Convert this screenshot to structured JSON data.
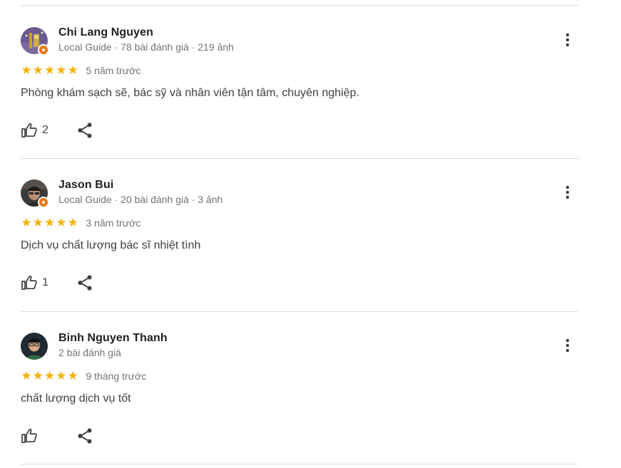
{
  "reviews": [
    {
      "name": "Chi Lang Nguyen",
      "meta": "Local Guide · 78 bài đánh giá · 219 ảnh",
      "local_guide": true,
      "rating": 5,
      "when": "5 năm trước",
      "text": "Phòng khám sạch sẽ, bác sỹ và nhân viên tận tâm, chuyên nghiệp.",
      "likes": "2",
      "avatar_colors": [
        "#6b5a8f",
        "#c9a227"
      ]
    },
    {
      "name": "Jason Bui",
      "meta": "Local Guide · 20 bài đánh giá · 3 ảnh",
      "local_guide": true,
      "rating": 5,
      "when": "3 năm trước",
      "text": "Dịch vụ chất lượng bác sĩ nhiệt tình",
      "likes": "1",
      "avatar_colors": [
        "#3a3a3a",
        "#8a6d5a"
      ]
    },
    {
      "name": "Binh Nguyen Thanh",
      "meta": "2 bài đánh giá",
      "local_guide": false,
      "rating": 5,
      "when": "9 tháng trước",
      "text": "chất lượng dịch vụ tốt",
      "likes": "",
      "avatar_colors": [
        "#1f2a33",
        "#d9a887"
      ]
    }
  ],
  "colors": {
    "star": "#f3b30d",
    "badge": "#e8710a",
    "divider": "#dadce0",
    "meta_text": "#70757a"
  },
  "icons": {
    "like": "thumbs-up-icon",
    "share": "share-icon",
    "more": "more-vert-icon",
    "badge": "local-guide-star-icon"
  }
}
